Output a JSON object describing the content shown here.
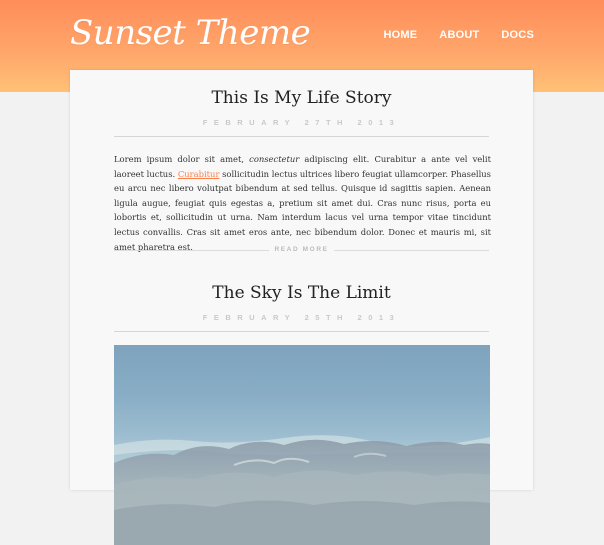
{
  "site": {
    "logo": "Sunset Theme",
    "nav": [
      "HOME",
      "ABOUT",
      "DOCS"
    ]
  },
  "posts": [
    {
      "title": "This Is My Life Story",
      "date": "FEBRUARY 27TH 2013",
      "excerpt_before_em": "Lorem ipsum dolor sit amet, ",
      "excerpt_em": "consectetur",
      "excerpt_mid": " adipiscing elit. Curabitur a ante vel velit laoreet luctus. ",
      "excerpt_link": "Curabitur",
      "excerpt_after": " sollicitudin lectus ultrices libero feugiat ullamcorper. Phasellus eu arcu nec libero volutpat bibendum at sed tellus. Quisque id sagittis sapien. Aenean ligula augue, feugiat quis egestas a, pretium sit amet dui. Cras nunc risus, porta eu lobortis et, sollicitudin ut urna. Nam interdum lacus vel urna tempor vitae tincidunt lectus convallis. Cras sit amet eros ante, nec bibendum dolor. Donec et mauris mi, sit amet pharetra est.",
      "read_more": "READ MORE"
    },
    {
      "title": "The Sky Is The Limit",
      "date": "FEBRUARY 25TH 2013"
    }
  ],
  "colors": {
    "accent": "#ff7f4a",
    "header_top": "#ff8d5a",
    "header_bottom": "#ffc177"
  }
}
